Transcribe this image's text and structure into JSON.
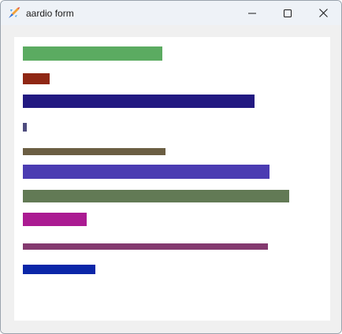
{
  "window": {
    "title": "aardio form",
    "icon": "aardio-app-icon",
    "controls": {
      "minimize_icon": "minimize-icon",
      "maximize_icon": "maximize-icon",
      "close_icon": "close-icon"
    }
  },
  "bars": [
    {
      "id": "bar-1",
      "color": "#5bab61",
      "value": 0.461
    },
    {
      "id": "bar-2",
      "color": "#8f2714",
      "value": 0.088
    },
    {
      "id": "bar-3",
      "color": "#221981",
      "value": 0.764
    },
    {
      "id": "bar-4",
      "color": "#4e4c7e",
      "value": 0.013
    },
    {
      "id": "bar-5",
      "color": "#6b5e43",
      "value": 0.47
    },
    {
      "id": "bar-6",
      "color": "#4b3cb2",
      "value": 0.812
    },
    {
      "id": "bar-7",
      "color": "#627a55",
      "value": 0.878
    },
    {
      "id": "bar-8",
      "color": "#ab1b92",
      "value": 0.21
    },
    {
      "id": "bar-9",
      "color": "#843a6f",
      "value": 0.808
    },
    {
      "id": "bar-10",
      "color": "#0b26a8",
      "value": 0.239
    }
  ]
}
